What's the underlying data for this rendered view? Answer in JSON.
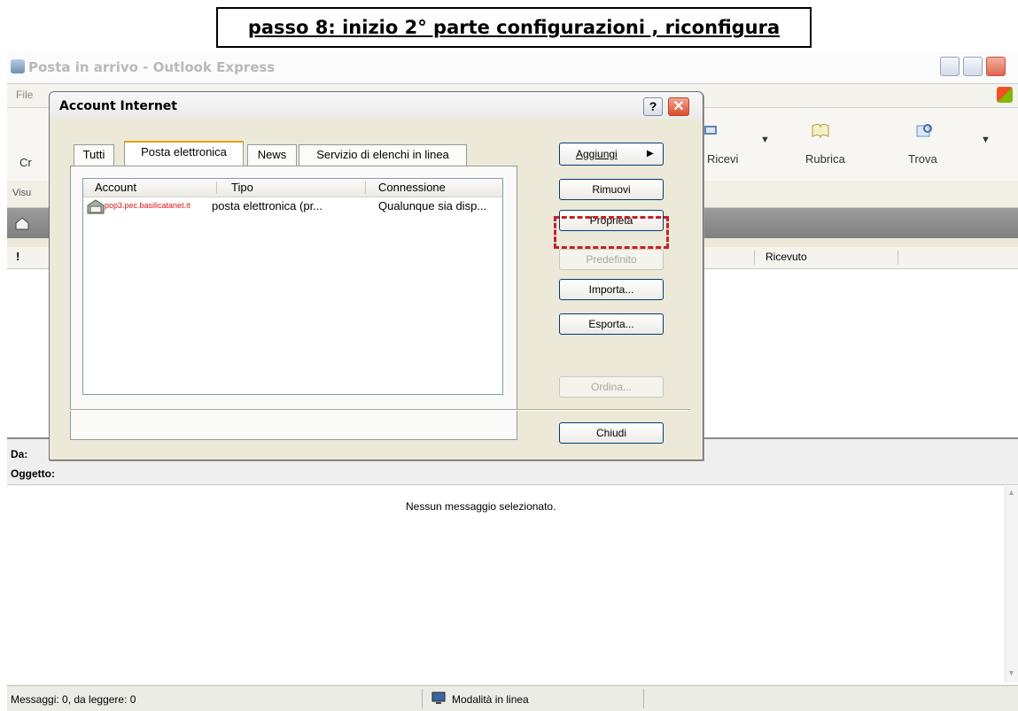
{
  "caption": "passo 8: inizio 2° parte configurazioni , riconfigura",
  "outlook": {
    "title": "Posta in arrivo - Outlook Express",
    "menu_hint": "File",
    "toolbar": {
      "create_fragment": "Cr",
      "receive": "Ricevi",
      "addressbook": "Rubrica",
      "find": "Trova"
    },
    "views_fragment": "Visu",
    "list_received": "Ricevuto",
    "list_flag": "!",
    "preview_from": "Da:",
    "preview_subject": "Oggetto:",
    "preview_empty": "Nessun messaggio selezionato.",
    "status_left": "Messaggi: 0, da leggere: 0",
    "status_mode": "Modalità in linea"
  },
  "dialog": {
    "title": "Account Internet",
    "help": "?",
    "close": "✕",
    "tabs": [
      "Tutti",
      "Posta elettronica",
      "News",
      "Servizio di elenchi in linea"
    ],
    "columns": [
      "Account",
      "Tipo",
      "Connessione"
    ],
    "rows": [
      {
        "account": "pop3.pec.basilicatanet.it",
        "type": "posta elettronica (pr...",
        "connection": "Qualunque sia disp..."
      }
    ],
    "buttons": {
      "add": "Aggiungi",
      "remove": "Rimuovi",
      "properties": "Proprietà",
      "default": "Predefinito",
      "import": "Importa...",
      "export": "Esporta...",
      "order": "Ordina...",
      "close": "Chiudi"
    },
    "highlight_color": "#c2222b"
  }
}
